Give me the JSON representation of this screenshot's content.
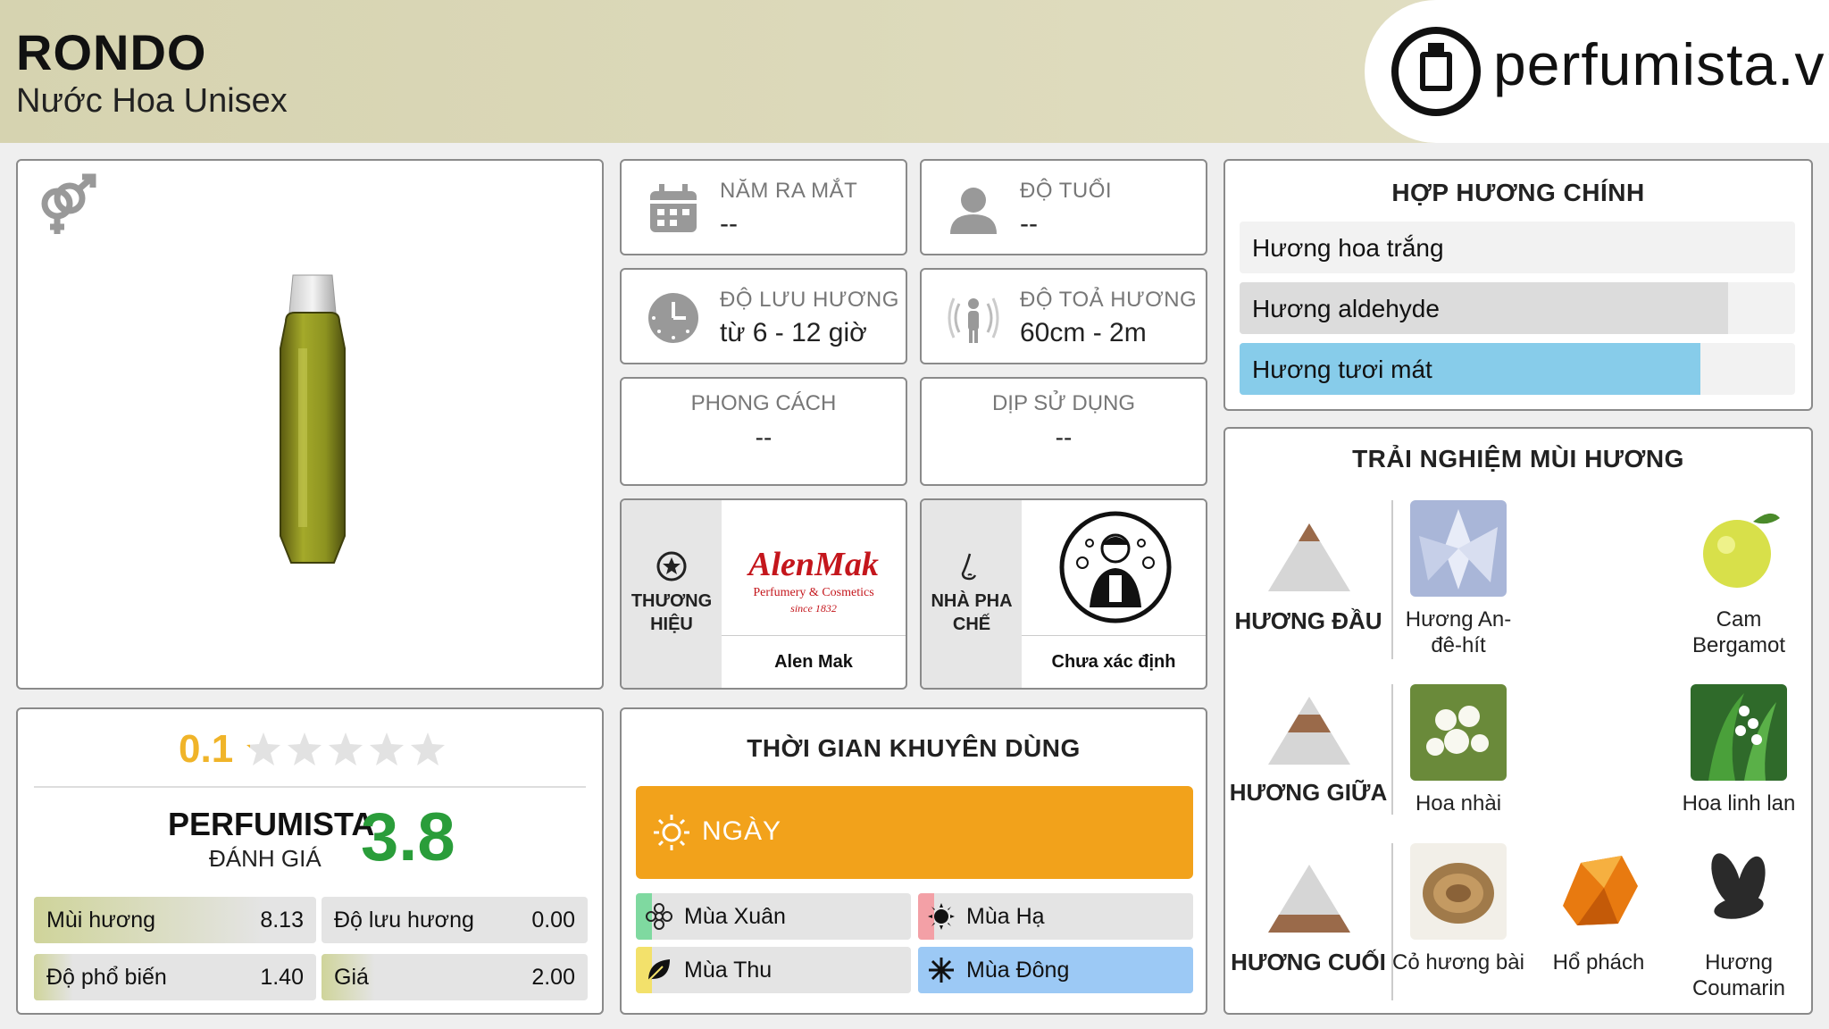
{
  "header": {
    "title": "RONDO",
    "subtitle": "Nước Hoa Unisex",
    "logo_text": "perfumista.vn"
  },
  "icons": {
    "gender": "unisex-gender-icon",
    "calendar": "calendar-icon",
    "age": "person-icon",
    "longevity": "clock-icon",
    "sillage": "radiating-person-icon",
    "brand": "star-badge-icon",
    "perfumer": "nose-icon",
    "day": "sun-icon"
  },
  "info": {
    "release_label": "NĂM RA MẮT",
    "release_value": "--",
    "age_label": "ĐỘ TUỔI",
    "age_value": "--",
    "longevity_label": "ĐỘ LƯU HƯƠNG",
    "longevity_value": "từ 6 - 12 giờ",
    "sillage_label": "ĐỘ TOẢ HƯƠNG",
    "sillage_value": "60cm - 2m",
    "style_label": "PHONG CÁCH",
    "style_value": "--",
    "occasion_label": "DỊP SỬ DỤNG",
    "occasion_value": "--",
    "brand_label_1": "THƯƠNG",
    "brand_label_2": "HIỆU",
    "brand_name": "Alen Mak",
    "brand_logo_text": "AlenMak",
    "brand_logo_sub": "Perfumery & Cosmetics",
    "brand_logo_since": "since 1832",
    "perfumer_label_1": "NHÀ PHA",
    "perfumer_label_2": "CHẾ",
    "perfumer_name": "Chưa xác định"
  },
  "rating": {
    "user_score": "0.1",
    "user_stars_fraction": 0.02,
    "pf_label": "PERFUMISTA",
    "pf_sub": "ĐÁNH GIÁ",
    "pf_score": "3.8",
    "metrics": [
      {
        "label": "Mùi hương",
        "value": "8.13",
        "fraction": 0.813
      },
      {
        "label": "Độ lưu hương",
        "value": "0.00",
        "fraction": 0.0
      },
      {
        "label": "Độ phổ biến",
        "value": "1.40",
        "fraction": 0.14
      },
      {
        "label": "Giá",
        "value": "2.00",
        "fraction": 0.2
      }
    ]
  },
  "time_of_use": {
    "title": "THỜI GIAN KHUYÊN DÙNG",
    "day_label": "NGÀY",
    "seasons": [
      {
        "label": "Mùa Xuân",
        "fraction": 0.06,
        "color": "#7fd9a0",
        "icon": "flower-icon"
      },
      {
        "label": "Mùa Hạ",
        "fraction": 0.06,
        "color": "#f3a0a6",
        "icon": "sun-icon"
      },
      {
        "label": "Mùa Thu",
        "fraction": 0.06,
        "color": "#f3e16b",
        "icon": "leaf-icon"
      },
      {
        "label": "Mùa Đông",
        "fraction": 1.0,
        "color": "#9cc9f5",
        "icon": "snowflake-icon"
      }
    ]
  },
  "accords": {
    "title": "HỢP HƯƠNG CHÍNH",
    "items": [
      {
        "label": "Hương hoa trắng",
        "fraction": 0.0,
        "color": "#ffffff"
      },
      {
        "label": "Hương aldehyde",
        "fraction": 0.88,
        "color": "#dcdcdc"
      },
      {
        "label": "Hương tươi mát",
        "fraction": 0.83,
        "color": "#87ccea"
      }
    ]
  },
  "notes": {
    "title": "TRẢI NGHIỆM MÙI HƯƠNG",
    "top_label": "HƯƠNG ĐẦU",
    "middle_label": "HƯƠNG GIỮA",
    "base_label": "HƯƠNG CUỐI",
    "top": [
      {
        "name": "Hương An-đê-hít",
        "icon": "aldehyde-crystal-icon"
      },
      {
        "name": "Cam Bergamot",
        "icon": "bergamot-icon"
      }
    ],
    "middle": [
      {
        "name": "Hoa nhài",
        "icon": "jasmine-icon"
      },
      {
        "name": "Hoa linh lan",
        "icon": "lily-of-the-valley-icon"
      }
    ],
    "base": [
      {
        "name": "Cỏ hương bài",
        "icon": "vetiver-icon"
      },
      {
        "name": "Hổ phách",
        "icon": "amber-icon"
      },
      {
        "name": "Hương Coumarin",
        "icon": "tonka-bean-icon"
      }
    ]
  }
}
